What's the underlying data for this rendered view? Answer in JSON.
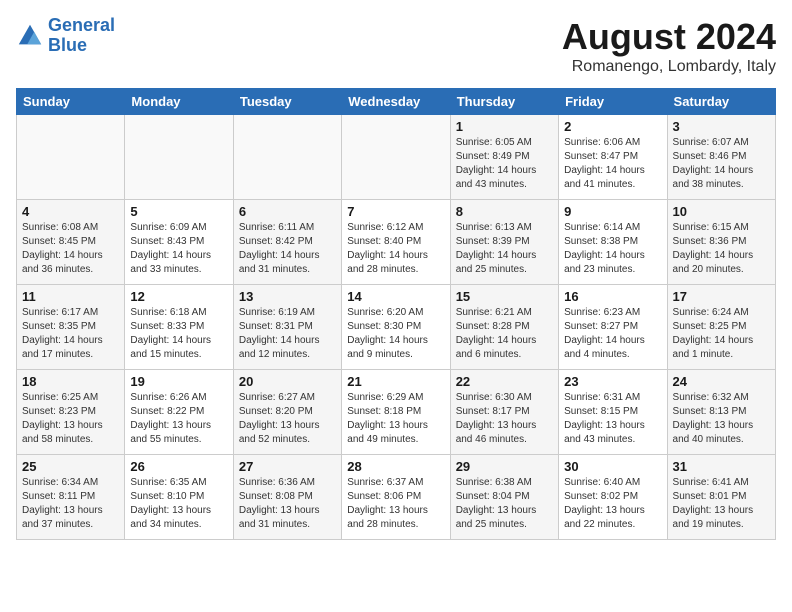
{
  "logo": {
    "line1": "General",
    "line2": "Blue"
  },
  "title": "August 2024",
  "location": "Romanengo, Lombardy, Italy",
  "days_of_week": [
    "Sunday",
    "Monday",
    "Tuesday",
    "Wednesday",
    "Thursday",
    "Friday",
    "Saturday"
  ],
  "weeks": [
    [
      {
        "day": "",
        "info": ""
      },
      {
        "day": "",
        "info": ""
      },
      {
        "day": "",
        "info": ""
      },
      {
        "day": "",
        "info": ""
      },
      {
        "day": "1",
        "info": "Sunrise: 6:05 AM\nSunset: 8:49 PM\nDaylight: 14 hours\nand 43 minutes."
      },
      {
        "day": "2",
        "info": "Sunrise: 6:06 AM\nSunset: 8:47 PM\nDaylight: 14 hours\nand 41 minutes."
      },
      {
        "day": "3",
        "info": "Sunrise: 6:07 AM\nSunset: 8:46 PM\nDaylight: 14 hours\nand 38 minutes."
      }
    ],
    [
      {
        "day": "4",
        "info": "Sunrise: 6:08 AM\nSunset: 8:45 PM\nDaylight: 14 hours\nand 36 minutes."
      },
      {
        "day": "5",
        "info": "Sunrise: 6:09 AM\nSunset: 8:43 PM\nDaylight: 14 hours\nand 33 minutes."
      },
      {
        "day": "6",
        "info": "Sunrise: 6:11 AM\nSunset: 8:42 PM\nDaylight: 14 hours\nand 31 minutes."
      },
      {
        "day": "7",
        "info": "Sunrise: 6:12 AM\nSunset: 8:40 PM\nDaylight: 14 hours\nand 28 minutes."
      },
      {
        "day": "8",
        "info": "Sunrise: 6:13 AM\nSunset: 8:39 PM\nDaylight: 14 hours\nand 25 minutes."
      },
      {
        "day": "9",
        "info": "Sunrise: 6:14 AM\nSunset: 8:38 PM\nDaylight: 14 hours\nand 23 minutes."
      },
      {
        "day": "10",
        "info": "Sunrise: 6:15 AM\nSunset: 8:36 PM\nDaylight: 14 hours\nand 20 minutes."
      }
    ],
    [
      {
        "day": "11",
        "info": "Sunrise: 6:17 AM\nSunset: 8:35 PM\nDaylight: 14 hours\nand 17 minutes."
      },
      {
        "day": "12",
        "info": "Sunrise: 6:18 AM\nSunset: 8:33 PM\nDaylight: 14 hours\nand 15 minutes."
      },
      {
        "day": "13",
        "info": "Sunrise: 6:19 AM\nSunset: 8:31 PM\nDaylight: 14 hours\nand 12 minutes."
      },
      {
        "day": "14",
        "info": "Sunrise: 6:20 AM\nSunset: 8:30 PM\nDaylight: 14 hours\nand 9 minutes."
      },
      {
        "day": "15",
        "info": "Sunrise: 6:21 AM\nSunset: 8:28 PM\nDaylight: 14 hours\nand 6 minutes."
      },
      {
        "day": "16",
        "info": "Sunrise: 6:23 AM\nSunset: 8:27 PM\nDaylight: 14 hours\nand 4 minutes."
      },
      {
        "day": "17",
        "info": "Sunrise: 6:24 AM\nSunset: 8:25 PM\nDaylight: 14 hours\nand 1 minute."
      }
    ],
    [
      {
        "day": "18",
        "info": "Sunrise: 6:25 AM\nSunset: 8:23 PM\nDaylight: 13 hours\nand 58 minutes."
      },
      {
        "day": "19",
        "info": "Sunrise: 6:26 AM\nSunset: 8:22 PM\nDaylight: 13 hours\nand 55 minutes."
      },
      {
        "day": "20",
        "info": "Sunrise: 6:27 AM\nSunset: 8:20 PM\nDaylight: 13 hours\nand 52 minutes."
      },
      {
        "day": "21",
        "info": "Sunrise: 6:29 AM\nSunset: 8:18 PM\nDaylight: 13 hours\nand 49 minutes."
      },
      {
        "day": "22",
        "info": "Sunrise: 6:30 AM\nSunset: 8:17 PM\nDaylight: 13 hours\nand 46 minutes."
      },
      {
        "day": "23",
        "info": "Sunrise: 6:31 AM\nSunset: 8:15 PM\nDaylight: 13 hours\nand 43 minutes."
      },
      {
        "day": "24",
        "info": "Sunrise: 6:32 AM\nSunset: 8:13 PM\nDaylight: 13 hours\nand 40 minutes."
      }
    ],
    [
      {
        "day": "25",
        "info": "Sunrise: 6:34 AM\nSunset: 8:11 PM\nDaylight: 13 hours\nand 37 minutes."
      },
      {
        "day": "26",
        "info": "Sunrise: 6:35 AM\nSunset: 8:10 PM\nDaylight: 13 hours\nand 34 minutes."
      },
      {
        "day": "27",
        "info": "Sunrise: 6:36 AM\nSunset: 8:08 PM\nDaylight: 13 hours\nand 31 minutes."
      },
      {
        "day": "28",
        "info": "Sunrise: 6:37 AM\nSunset: 8:06 PM\nDaylight: 13 hours\nand 28 minutes."
      },
      {
        "day": "29",
        "info": "Sunrise: 6:38 AM\nSunset: 8:04 PM\nDaylight: 13 hours\nand 25 minutes."
      },
      {
        "day": "30",
        "info": "Sunrise: 6:40 AM\nSunset: 8:02 PM\nDaylight: 13 hours\nand 22 minutes."
      },
      {
        "day": "31",
        "info": "Sunrise: 6:41 AM\nSunset: 8:01 PM\nDaylight: 13 hours\nand 19 minutes."
      }
    ]
  ]
}
